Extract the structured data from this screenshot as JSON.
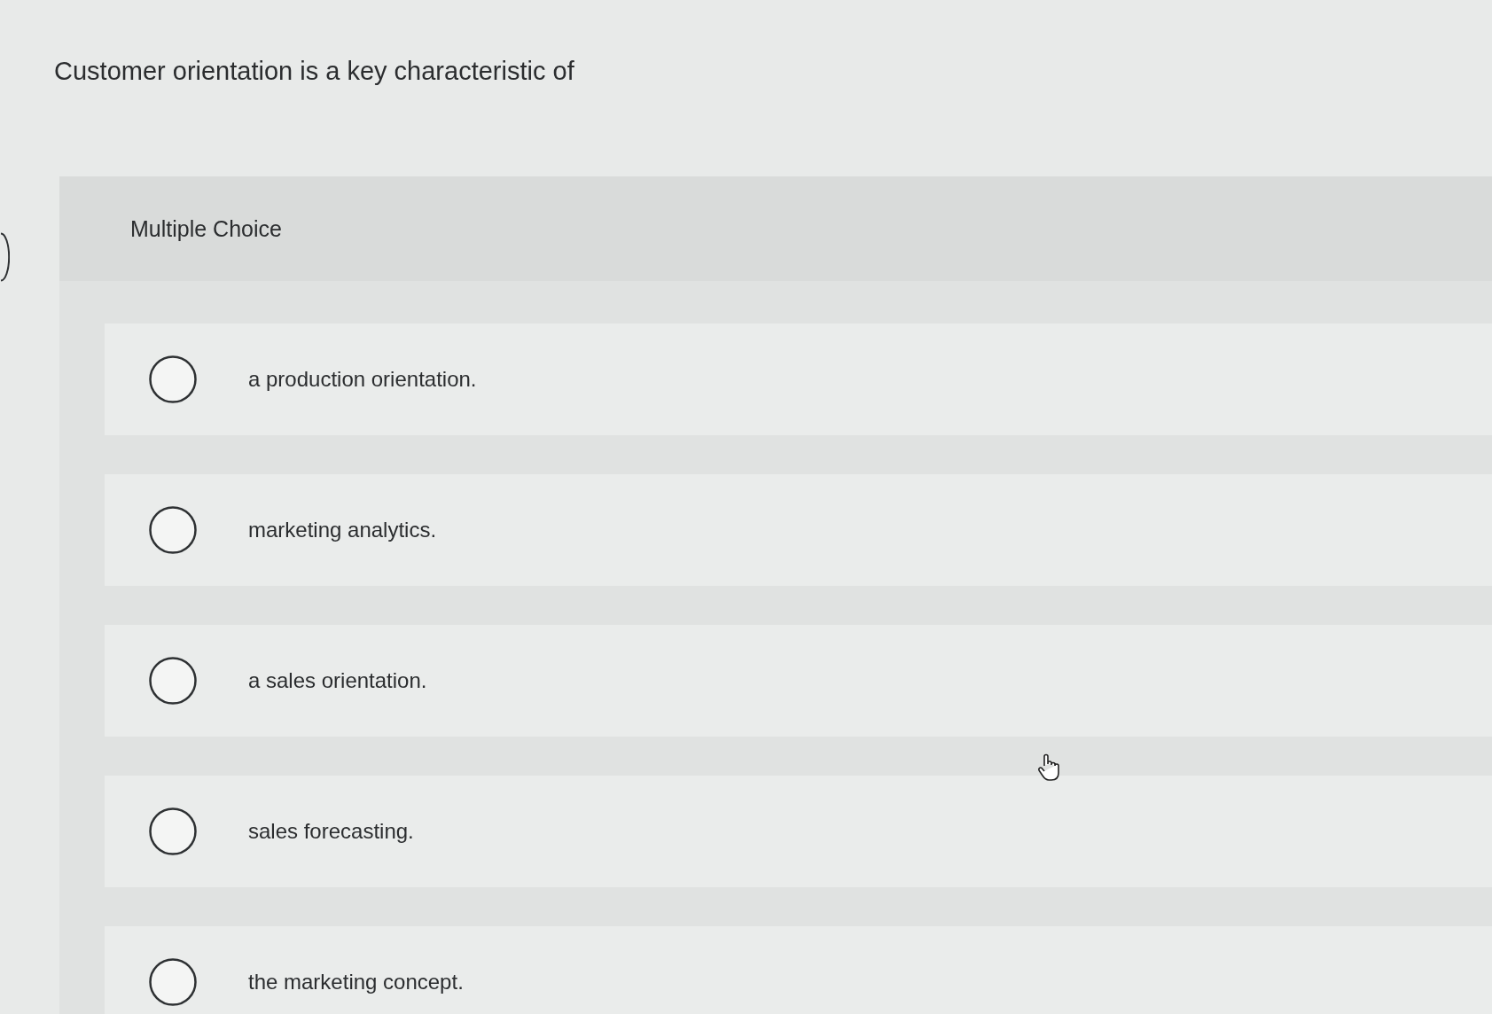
{
  "question": "Customer orientation is a key characteristic of",
  "panel": {
    "heading": "Multiple Choice"
  },
  "options": [
    {
      "label": "a production orientation.",
      "selected": false
    },
    {
      "label": "marketing analytics.",
      "selected": false
    },
    {
      "label": "a sales orientation.",
      "selected": false
    },
    {
      "label": "sales forecasting.",
      "selected": false
    },
    {
      "label": "the marketing concept.",
      "selected": false
    }
  ]
}
